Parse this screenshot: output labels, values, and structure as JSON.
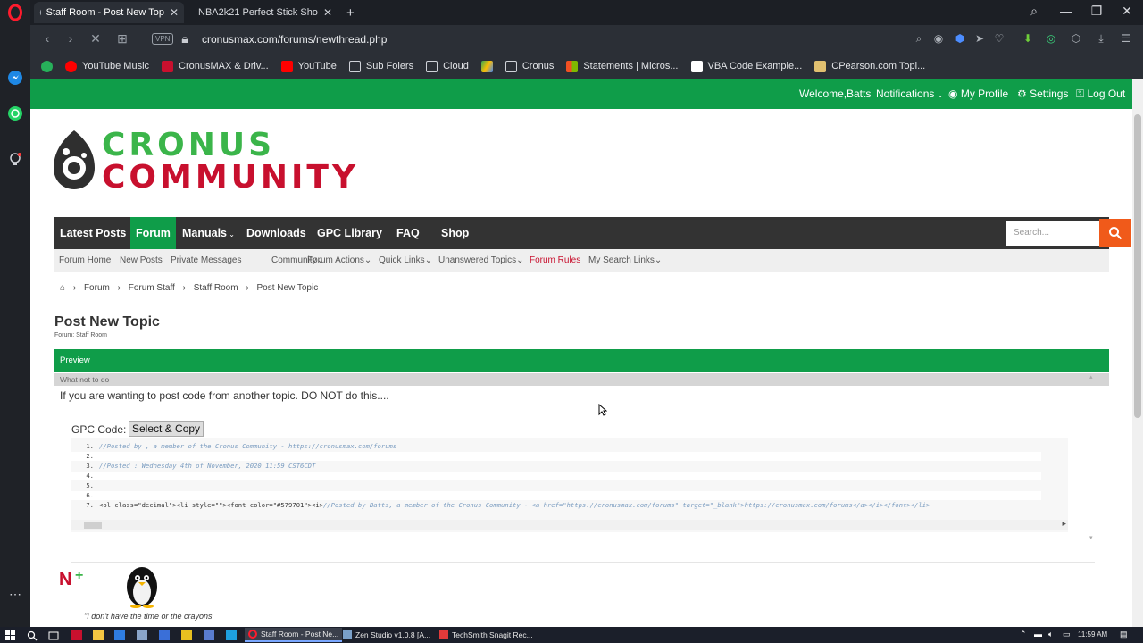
{
  "browser": {
    "tabs": [
      {
        "title": "Staff Room - Post New Top",
        "active": true
      },
      {
        "title": "NBA2k21 Perfect Stick Sho",
        "active": false
      }
    ],
    "new_tab_label": "+",
    "url": "cronusmax.com/forums/newthread.php",
    "vpn_label": "VPN",
    "bookmarks": [
      {
        "label": "YouTube Music",
        "color": "#ff0000"
      },
      {
        "label": "CronusMAX & Driv...",
        "color": "#c8102e"
      },
      {
        "label": "YouTube",
        "color": "#ff0000"
      },
      {
        "label": "Sub Folers",
        "color": "#cfd2d8"
      },
      {
        "label": "Cloud",
        "color": "#cfd2d8"
      },
      {
        "label": "",
        "color": "#34a853"
      },
      {
        "label": "Cronus",
        "color": "#cfd2d8"
      },
      {
        "label": "Statements | Micros...",
        "color": "#f25022"
      },
      {
        "label": "VBA Code Example...",
        "color": "#ffffff"
      },
      {
        "label": "CPearson.com Topi...",
        "color": "#e0c070"
      }
    ]
  },
  "site": {
    "topbar": {
      "welcome": "Welcome,",
      "user": "Batts",
      "notifications": "Notifications",
      "my_profile": "My Profile",
      "settings": "Settings",
      "logout": "Log Out"
    },
    "logo_line1": "CRONUS",
    "logo_line2": "COMMUNITY",
    "main_nav": [
      "Latest Posts",
      "Forum",
      "Manuals",
      "Downloads",
      "GPC Library",
      "FAQ",
      "Shop"
    ],
    "search_placeholder": "Search...",
    "sub_nav": [
      "Forum Home",
      "New Posts",
      "Private Messages",
      "Community",
      "Forum Actions",
      "Quick Links",
      "Unanswered Topics",
      "Forum Rules",
      "My Search Links"
    ],
    "breadcrumb": [
      "Forum",
      "Forum Staff",
      "Staff Room",
      "Post New Topic"
    ],
    "page_title": "Post New Topic",
    "page_subtitle": "Forum: Staff Room",
    "preview_label": "Preview",
    "what_not_label": "What not to do",
    "post_text": "If you are wanting to post code from another topic. DO NOT do this....",
    "gpc_label": "GPC Code:",
    "copy_button": "Select & Copy",
    "code_lines": [
      {
        "num": "1.",
        "text": "//Posted by , a member of the Cronus Community - https://cronusmax.com/forums",
        "kind": "comment"
      },
      {
        "num": "2.",
        "text": "",
        "kind": "plain"
      },
      {
        "num": "3.",
        "text": "//Posted : Wednesday 4th of November, 2020 11:59 CST6CDT",
        "kind": "comment"
      },
      {
        "num": "4.",
        "text": "",
        "kind": "plain"
      },
      {
        "num": "5.",
        "text": "",
        "kind": "plain"
      },
      {
        "num": "6.",
        "text": "",
        "kind": "plain"
      },
      {
        "num": "7.",
        "text": "<ol class=\"decimal\"><li style=\"\"><font color=\"#579701\"><i>",
        "comment": "//Posted by Batts, a member of the Cronus Community - <a href=\"https://cronusmax.com/forums\" target=\"_blank\">https://cronusmax.com/forums</a></i></font></li>",
        "kind": "mixed"
      }
    ],
    "signature_quote": "\"I don't have the time or the crayons"
  },
  "taskbar": {
    "apps": [
      {
        "label": "Staff Room - Post Ne...",
        "active": true
      },
      {
        "label": "Zen Studio v1.0.8 [A...",
        "active": false
      },
      {
        "label": "TechSmith Snagit Rec...",
        "active": false
      }
    ],
    "time": "11:59 AM"
  },
  "colors": {
    "brand_green": "#0f9d49",
    "brand_red": "#c8102e",
    "search_orange": "#f05a1a"
  }
}
